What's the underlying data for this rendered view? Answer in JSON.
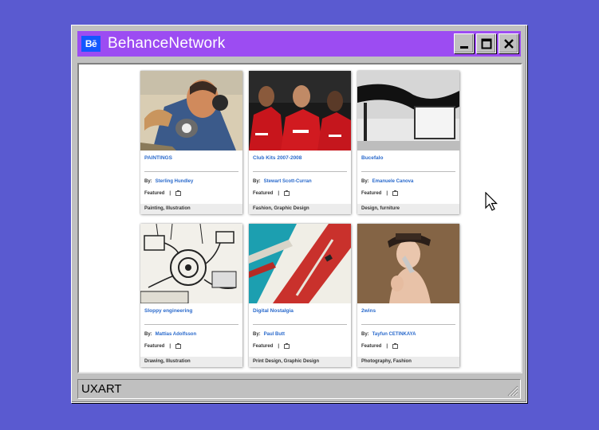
{
  "window": {
    "title": "BehanceNetwork",
    "logo_text": "Bē",
    "status": "UXART"
  },
  "projects": [
    {
      "title": "PAINTINGS",
      "by_label": "By:",
      "author": "Sterling Hundley",
      "featured": "Featured",
      "tags": "Painting, Illustration",
      "thumb_icon": "portrait-painting"
    },
    {
      "title": "Club Kits 2007-2008",
      "by_label": "By:",
      "author": "Stewart Scott-Curran",
      "featured": "Featured",
      "tags": "Fashion, Graphic Design",
      "thumb_icon": "football-players"
    },
    {
      "title": "Bucefalo",
      "by_label": "By:",
      "author": "Emanuele Canova",
      "featured": "Featured",
      "tags": "Design, furniture",
      "thumb_icon": "furniture"
    },
    {
      "title": "Sloppy engineering",
      "by_label": "By:",
      "author": "Mattias Adolfsson",
      "featured": "Featured",
      "tags": "Drawing, Illustration",
      "thumb_icon": "machine-drawing"
    },
    {
      "title": "Digital Nostalgia",
      "by_label": "By:",
      "author": "Paul Butt",
      "featured": "Featured",
      "tags": "Print Design, Graphic Design",
      "thumb_icon": "graphic-print"
    },
    {
      "title": "2wins",
      "by_label": "By:",
      "author": "Tayfun CETINKAYA",
      "featured": "Featured",
      "tags": "Photography, Fashion",
      "thumb_icon": "fashion-photo"
    }
  ],
  "colors": {
    "desktop": "#5a5ad0",
    "titlebar": "#9c4cf2",
    "link": "#2a6acc",
    "logo": "#1357ff"
  }
}
